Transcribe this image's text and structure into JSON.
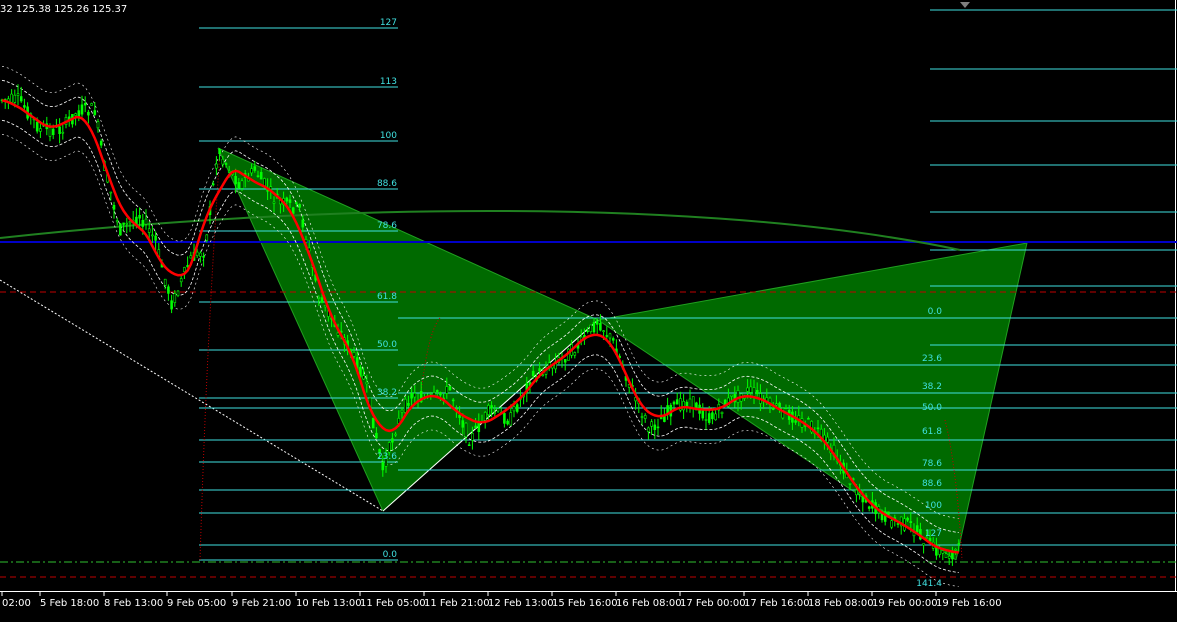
{
  "header": {
    "ohlc_text": "32 125.38 125.26 125.37"
  },
  "colors": {
    "background": "#000000",
    "candle": "#00ff00",
    "pattern_fill": "#007000",
    "fib_line": "#40e0e0",
    "fib_text": "#40e0e0",
    "moving_average": "#ff0000",
    "envelope": "#ffffff",
    "horizontal_level": "#0000c8",
    "long_ma": "#208020",
    "dashed_level": "#c00000"
  },
  "fib_left": [
    "127",
    "113",
    "100",
    "88.6",
    "78.6",
    "61.8",
    "50.0",
    "38.2",
    "23.6",
    "0.0"
  ],
  "fib_right": [
    "0.0",
    "23.6",
    "38.2",
    "50.0",
    "61.8",
    "78.6",
    "88.6",
    "100",
    "127",
    "141.4"
  ],
  "x_axis_labels": [
    "02:00",
    "5 Feb 18:00",
    "8 Feb 13:00",
    "9 Feb 05:00",
    "9 Feb 21:00",
    "10 Feb 13:00",
    "11 Feb 05:00",
    "11 Feb 21:00",
    "12 Feb 13:00",
    "15 Feb 16:00",
    "16 Feb 08:00",
    "17 Feb 00:00",
    "17 Feb 16:00",
    "18 Feb 08:00",
    "19 Feb 00:00",
    "19 Feb 16:00"
  ]
}
